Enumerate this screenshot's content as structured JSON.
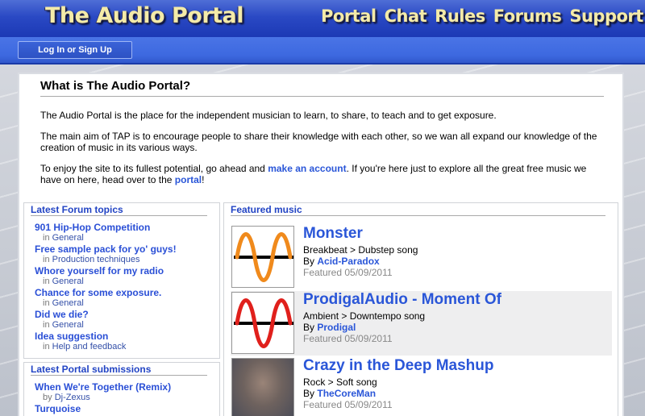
{
  "header": {
    "logo": "The Audio Portal",
    "nav": [
      "Portal",
      "Chat",
      "Rules",
      "Forums",
      "Support"
    ]
  },
  "subbar": {
    "login_label": "Log In or Sign Up"
  },
  "intro": {
    "title": "What is The Audio Portal?",
    "p1": "The Audio Portal is the place for the independent musician to learn, to share, to teach and to get exposure.",
    "p2": "The main aim of TAP is to encourage people to share their knowledge with each other, so we wan all expand our knowledge of the creation of music in its various ways.",
    "p3_a": "To enjoy the site to its fullest potential, go ahead and ",
    "p3_link1": "make an account",
    "p3_b": ". If you're here just to explore all the great free music we have on here, head over to the ",
    "p3_link2": "portal",
    "p3_c": "!"
  },
  "forum": {
    "title": "Latest Forum topics",
    "in_word": "in",
    "topics": [
      {
        "title": "901 Hip-Hop Competition",
        "category": "General"
      },
      {
        "title": "Free sample pack for yo' guys!",
        "category": "Production techniques"
      },
      {
        "title": "Whore yourself for my radio",
        "category": "General"
      },
      {
        "title": "Chance for some exposure.",
        "category": "General"
      },
      {
        "title": "Did we die?",
        "category": "General"
      },
      {
        "title": "Idea suggestion",
        "category": "Help and feedback"
      }
    ]
  },
  "submissions": {
    "title": "Latest Portal submissions",
    "by_word": "by",
    "items": [
      {
        "title": "When We're Together (Remix)",
        "artist": "Dj-Zexus"
      },
      {
        "title": "Turquoise",
        "artist": ""
      }
    ]
  },
  "featured": {
    "title": "Featured music",
    "by_word": "By",
    "items": [
      {
        "title": "Monster",
        "genre": "Breakbeat > Dubstep song",
        "artist": "Acid-Paradox",
        "date": "Featured 05/09/2011",
        "wave_color": "#f08a1c"
      },
      {
        "title": "ProdigalAudio - Moment Of",
        "genre": "Ambient > Downtempo song",
        "artist": "Prodigal",
        "date": "Featured 05/09/2011",
        "wave_color": "#e0201c"
      },
      {
        "title": "Crazy in the Deep Mashup",
        "genre": "Rock > Soft song",
        "artist": "TheCoreMan",
        "date": "Featured 05/09/2011",
        "wave_color": ""
      }
    ]
  },
  "colors": {
    "link_blue": "#2a56d8",
    "logo_yellow": "#f4eba8",
    "header_blue": "#2a49c4"
  }
}
